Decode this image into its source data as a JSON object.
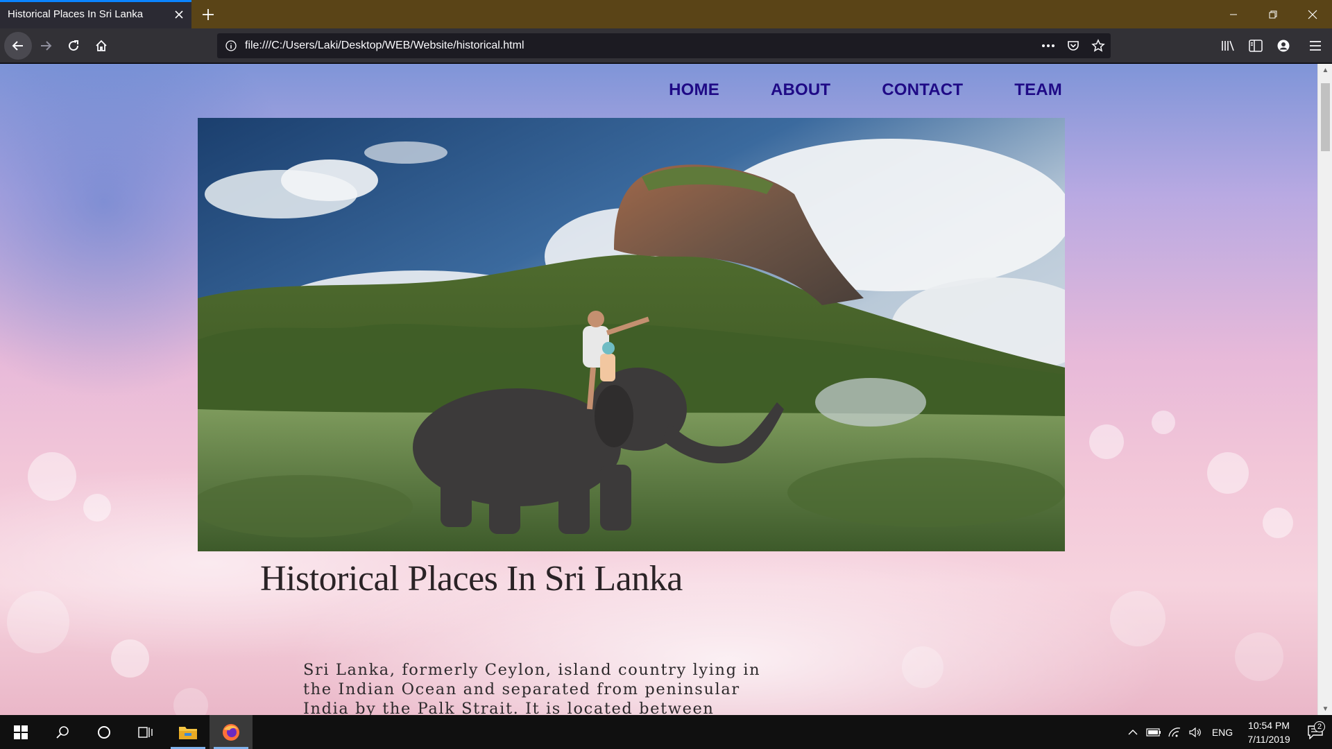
{
  "browser": {
    "tab_title": "Historical Places In Sri Lanka",
    "url": "file:///C:/Users/Laki/Desktop/WEB/Website/historical.html"
  },
  "site": {
    "nav": [
      {
        "label": "HOME"
      },
      {
        "label": "ABOUT"
      },
      {
        "label": "CONTACT"
      },
      {
        "label": "TEAM"
      }
    ],
    "heading": "Historical Places In Sri Lanka",
    "intro": "Sri Lanka, formerly Ceylon, island country lying in the Indian Ocean and separated from peninsular India by the Palk Strait. It is located between"
  },
  "taskbar": {
    "language": "ENG",
    "time": "10:54 PM",
    "date": "7/11/2019",
    "notification_count": "2"
  },
  "colors": {
    "nav_link": "#1f0a86",
    "tab_accent": "#0a84ff",
    "titlebar": "#5a4417"
  }
}
